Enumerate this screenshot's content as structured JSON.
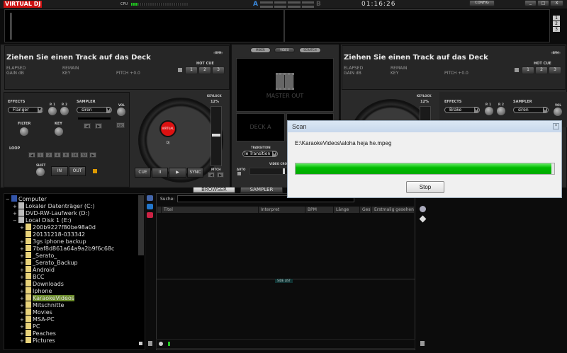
{
  "app": {
    "logo": "VIRTUAL DJ",
    "cpu_label": "CPU",
    "cpu_load": 0.12,
    "deck_a": "A",
    "deck_b": "B",
    "clock": "01:16:26",
    "config": "CONFIG",
    "win": {
      "min": "_",
      "max": "□",
      "close": "X"
    },
    "wave_numbers": [
      "1",
      "2",
      "3"
    ]
  },
  "left_deck": {
    "title": "Ziehen Sie einen Track auf das Deck",
    "bpm": "BPM",
    "elapsed": "ELAPSED",
    "remain": "REMAIN",
    "gain": "GAIN dB",
    "key": "KEY",
    "pitch": "PITCH +0.0",
    "hotcue": "HOT CUE",
    "hotcues": [
      "1",
      "2",
      "3"
    ],
    "effects": "EFFECTS",
    "effect_value": "Flanger",
    "p1": "P. 1",
    "p2": "P. 2",
    "sampler": "SAMPLER",
    "sampler_value": "siren",
    "vol": "VOL",
    "rec": "REC",
    "filter": "FILTER",
    "keyk": "KEY",
    "loop": "LOOP",
    "loops": [
      "1",
      "2",
      "4",
      "8",
      "16",
      "32"
    ],
    "shift": "SHIFT",
    "in": "IN",
    "out": "OUT",
    "keylock": "KEYLOCK",
    "pitch_range": "12%",
    "pitch_lbl": "PITCH",
    "transport": [
      "CUE",
      "II",
      "▶",
      "SYNC"
    ],
    "platter_label": "VIRTUAL DJ"
  },
  "center": {
    "tabs": [
      "MIXER",
      "VIDEO",
      "SCRATCH"
    ],
    "master_out": "MASTER OUT",
    "deck_a": "DECK A",
    "transition_lbl": "TRANSITION",
    "transition": "le Transition",
    "auto": "AUTO",
    "crossfader": "VIDEO CROSSFADER"
  },
  "right_deck": {
    "title": "Ziehen Sie einen Track auf das Deck",
    "bpm": "BPM",
    "elapsed": "ELAPSED",
    "remain": "REMAIN",
    "gain": "GAIN dB",
    "key": "KEY",
    "pitch": "PITCH +0.0",
    "hotcue": "HOT CUE",
    "hotcues": [
      "1",
      "2",
      "3"
    ],
    "keylock": "KEYLOCK",
    "pitch_range": "12%",
    "effects": "EFFECTS",
    "effect_value": "Brake",
    "p1": "P. 1",
    "p2": "P. 2",
    "sampler": "SAMPLER",
    "sampler_value": "siren",
    "vol": "VOL"
  },
  "browser": {
    "tabs": [
      "BROWSER",
      "SAMPLER"
    ],
    "search_label": "Suche:",
    "search_value": "",
    "columns": [
      "Titel",
      "Interpret",
      "BPM",
      "Länge",
      "Ges",
      "Erstmalig gesehen"
    ],
    "side_list": "SIDE LIST",
    "tree": [
      {
        "label": "Computer",
        "sign": "−"
      },
      {
        "label": "Lokaler Datenträger (C:)",
        "sign": "+"
      },
      {
        "label": "DVD-RW-Laufwerk (D:)",
        "sign": "+"
      },
      {
        "label": "Local Disk 1 (E:)",
        "sign": "−"
      },
      {
        "label": "200b9227f80be98a0d",
        "sign": "+"
      },
      {
        "label": "20131218-033342",
        "sign": ""
      },
      {
        "label": "3gs iphone backup",
        "sign": "+"
      },
      {
        "label": "7baf8d861a64a9a2b9f6c68c",
        "sign": "+"
      },
      {
        "label": "_Serato_",
        "sign": "+"
      },
      {
        "label": "_Serato_Backup",
        "sign": "+"
      },
      {
        "label": "Android",
        "sign": "+"
      },
      {
        "label": "BCC",
        "sign": "+"
      },
      {
        "label": "Downloads",
        "sign": "+"
      },
      {
        "label": "Iphone",
        "sign": "+"
      },
      {
        "label": "KaraokeVideos",
        "sign": "+",
        "selected": true
      },
      {
        "label": "Mitschnitte",
        "sign": "+"
      },
      {
        "label": "Movies",
        "sign": "+"
      },
      {
        "label": "MSA-PC",
        "sign": "+"
      },
      {
        "label": "PC",
        "sign": "+"
      },
      {
        "label": "Peaches",
        "sign": "+"
      },
      {
        "label": "Pictures",
        "sign": "+"
      }
    ]
  },
  "scan_dialog": {
    "title": "Scan",
    "path": "E:\\KaraokeVideos\\aloha heja he.mpeg",
    "progress": 0.99,
    "stop": "Stop",
    "progress_color": "#14c814"
  }
}
